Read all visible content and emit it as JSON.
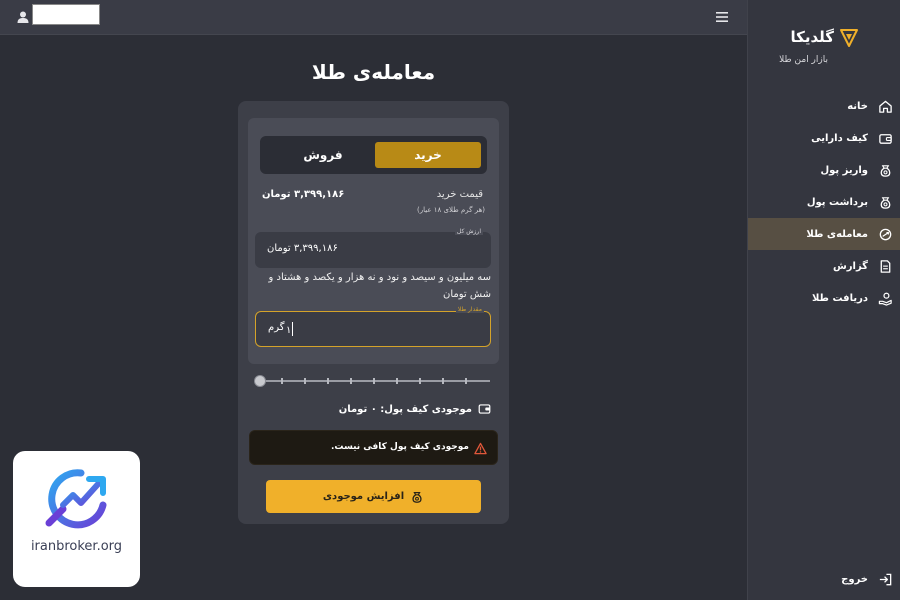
{
  "header": {
    "user_icon": "user-icon",
    "menu_icon": "hamburger-icon"
  },
  "sidebar": {
    "brand": "گلدیکا",
    "tagline": "بازار امن طلا",
    "items": [
      {
        "label": "خانه",
        "icon": "home-icon",
        "active": false
      },
      {
        "label": "کیف دارایی",
        "icon": "wallet-icon",
        "active": false
      },
      {
        "label": "واریز پول",
        "icon": "money-bag-icon",
        "active": false
      },
      {
        "label": "برداشت پول",
        "icon": "money-bag-icon",
        "active": false
      },
      {
        "label": "معامله‌ی طلا",
        "icon": "trade-icon",
        "active": true
      },
      {
        "label": "گزارش",
        "icon": "document-icon",
        "active": false
      },
      {
        "label": "دریافت طلا",
        "icon": "hand-coin-icon",
        "active": false
      }
    ],
    "logout": "خروج"
  },
  "page": {
    "title": "معامله‌ی طلا"
  },
  "trade": {
    "tabs": {
      "buy": "خرید",
      "sell": "فروش",
      "selected": "buy"
    },
    "price_label": "قیمت خرید",
    "price_sub": "(هر گرم طلای ۱۸ عیار)",
    "price_value": "۳,۳۹۹,۱۸۶ تومان",
    "total_legend": "ارزش کل",
    "total_value": "۳,۳۹۹,۱۸۶   تومان",
    "total_words": "سه میلیون و سیصد و نود و نه هزار و یکصد و هشتاد و شش تومان",
    "gram_legend": "مقدار طلا",
    "gram_unit": "گرم",
    "gram_value": "۱",
    "slider_position": 0,
    "wallet_balance": "موجودی کیف پول: ۰ تومان",
    "alert": "موجودی کیف پول کافی نیست.",
    "deposit_button": "افزایش موجودی"
  },
  "watermark": {
    "text": "iranbroker.org"
  },
  "colors": {
    "accent": "#f0b02a",
    "tab_active": "#b88a16",
    "background": "#2c2e36",
    "sidebar_active": "#574f43"
  }
}
